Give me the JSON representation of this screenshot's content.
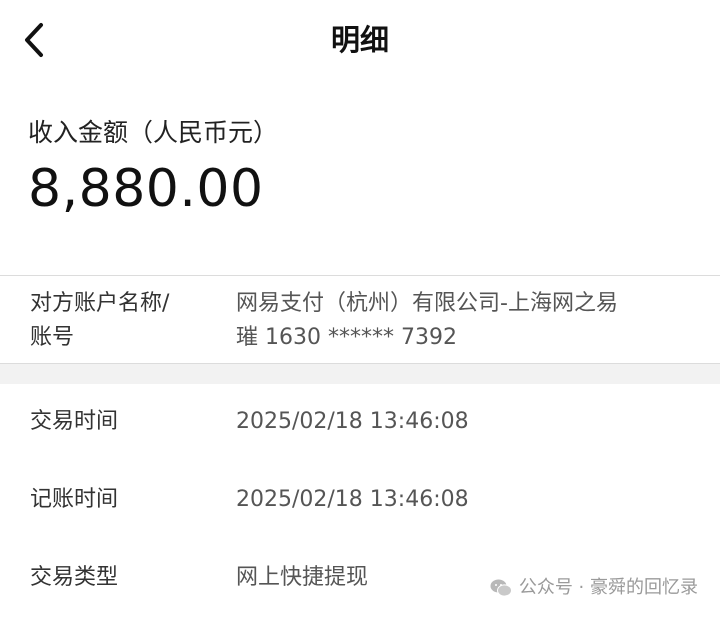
{
  "nav": {
    "title": "明细",
    "back_icon": "chevron-left-icon"
  },
  "summary": {
    "label": "收入金额（人民币元）",
    "amount": "8,880.00"
  },
  "counterparty": {
    "label_line1": "对方账户名称/",
    "label_line2": "账号",
    "value_line1": "网易支付（杭州）有限公司-上海网之易",
    "value_line2": "璀 1630 ****** 7392"
  },
  "details": [
    {
      "label": "交易时间",
      "value": "2025/02/18  13:46:08"
    },
    {
      "label": "记账时间",
      "value": "2025/02/18  13:46:08"
    },
    {
      "label": "交易类型",
      "value": "网上快捷提现"
    }
  ],
  "watermark": {
    "text": "公众号 · 豪舜的回忆录",
    "icon": "wechat-icon"
  }
}
